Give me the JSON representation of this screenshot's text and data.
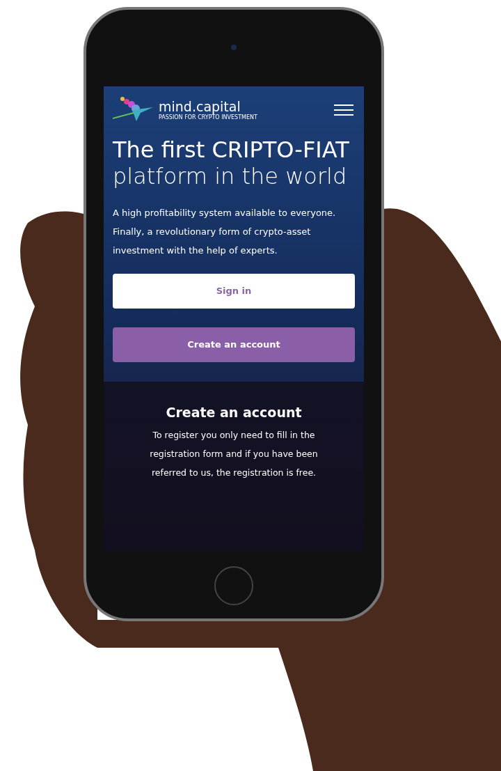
{
  "logo": {
    "name": "mind.capital",
    "tagline": "PASSION FOR CRYPTO INVESTMENT"
  },
  "hero": {
    "headline": "**The first CRIPTO-FIAT** platform in the world",
    "text": "A high profitability system available to everyone. Finally, a revolutionary form of crypto-asset investment with the help of experts."
  },
  "buttons": [
    {
      "label": "Sign in",
      "kind": "outline"
    },
    {
      "label": "Create an account",
      "kind": "primary"
    }
  ],
  "register": {
    "title": "Create an account",
    "text": "To register you only need to fill in the registration form and if you have been referred to us, the registration is free."
  }
}
